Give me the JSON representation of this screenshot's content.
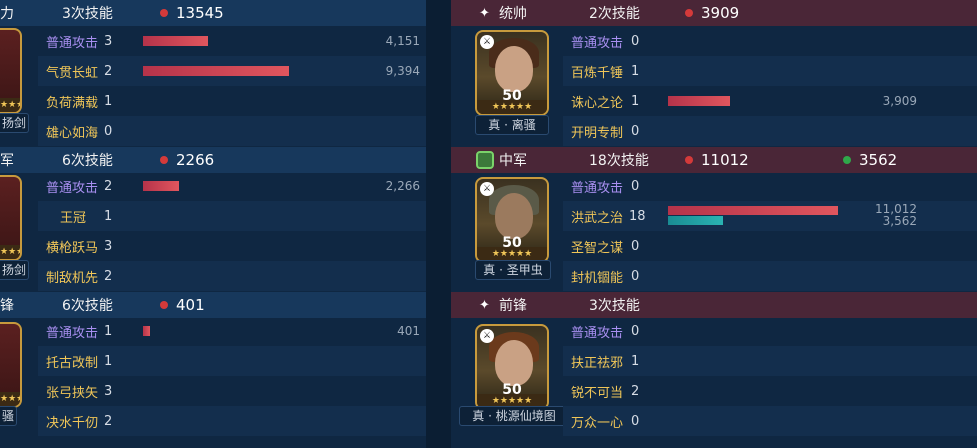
{
  "left": {
    "sections": [
      {
        "header": {
          "title": "力",
          "skills_count": "3次技能",
          "damage": "13545"
        },
        "name": "扬剑",
        "stars": "★★★",
        "rows": [
          {
            "skill": "普通攻击",
            "count": "3",
            "value": "4,151",
            "bar_fraction": 0.158
          },
          {
            "skill": "气贯长虹",
            "count": "2",
            "value": "9,394",
            "bar_fraction": 0.357
          },
          {
            "skill": "负荷满载",
            "count": "1",
            "value": ""
          },
          {
            "skill": "雄心如海",
            "count": "0",
            "value": ""
          }
        ]
      },
      {
        "header": {
          "title": "军",
          "skills_count": "6次技能",
          "damage": "2266"
        },
        "name": "扬剑",
        "stars": "★★★",
        "rows": [
          {
            "skill": "普通攻击",
            "count": "2",
            "value": "2,266",
            "bar_fraction": 0.086
          },
          {
            "skill": "王冠",
            "count": "1",
            "value": ""
          },
          {
            "skill": "横枪跃马",
            "count": "3",
            "value": ""
          },
          {
            "skill": "制敌机先",
            "count": "2",
            "value": ""
          }
        ]
      },
      {
        "header": {
          "title": "锋",
          "skills_count": "6次技能",
          "damage": "401"
        },
        "name": "骚",
        "stars": "★★★",
        "rows": [
          {
            "skill": "普通攻击",
            "count": "1",
            "value": "401",
            "bar_fraction": 0.015
          },
          {
            "skill": "托古改制",
            "count": "1",
            "value": ""
          },
          {
            "skill": "张弓挟矢",
            "count": "3",
            "value": ""
          },
          {
            "skill": "决水千仞",
            "count": "2",
            "value": ""
          }
        ]
      }
    ]
  },
  "right": {
    "sections": [
      {
        "header": {
          "title": "统帅",
          "skills_count": "2次技能",
          "damage": "3909"
        },
        "general": {
          "name": "真 · 离骚",
          "level": "50",
          "stars": "★★★★★"
        },
        "rows": [
          {
            "skill": "普通攻击",
            "count": "0",
            "value": ""
          },
          {
            "skill": "百炼千锤",
            "count": "1",
            "value": ""
          },
          {
            "skill": "诛心之论",
            "count": "1",
            "value": "3,909",
            "bar_fraction": 0.149
          },
          {
            "skill": "开明专制",
            "count": "0",
            "value": ""
          }
        ]
      },
      {
        "header": {
          "title": "中军",
          "skills_count": "18次技能",
          "damage": "11012",
          "heal": "3562"
        },
        "general": {
          "name": "真 · 圣甲虫",
          "level": "50",
          "stars": "★★★★★"
        },
        "rows": [
          {
            "skill": "普通攻击",
            "count": "0",
            "value": ""
          },
          {
            "skill": "洪武之治",
            "count": "18",
            "value": "11,012",
            "value2": "3,562",
            "bar_fraction": 0.42,
            "bar2_fraction": 0.136
          },
          {
            "skill": "圣智之谋",
            "count": "0",
            "value": ""
          },
          {
            "skill": "封机锢能",
            "count": "0",
            "value": ""
          }
        ]
      },
      {
        "header": {
          "title": "前锋",
          "skills_count": "3次技能"
        },
        "general": {
          "name": "真 · 桃源仙境图",
          "level": "50",
          "stars": "★★★★★"
        },
        "rows": [
          {
            "skill": "普通攻击",
            "count": "0",
            "value": ""
          },
          {
            "skill": "扶正祛邪",
            "count": "1",
            "value": ""
          },
          {
            "skill": "锐不可当",
            "count": "2",
            "value": ""
          },
          {
            "skill": "万众一心",
            "count": "0",
            "value": ""
          }
        ]
      }
    ]
  },
  "colors": {
    "damage_bar": "#d14a58",
    "heal_bar": "#23a3a8",
    "skill_purple": "#a88ff0",
    "skill_gold": "#f0c658",
    "header_blue": "#17385c",
    "header_red": "#4a2637"
  }
}
